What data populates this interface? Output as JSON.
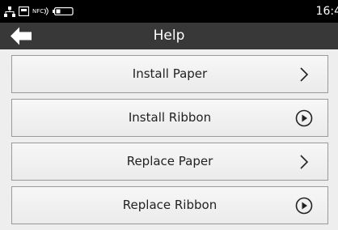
{
  "status_bar": {
    "time": "16:4",
    "icons": [
      "network-icon",
      "card-icon",
      "nfc-icon",
      "battery-icon"
    ],
    "nfc_label": "NFC"
  },
  "header": {
    "title": "Help",
    "back_icon": "back-arrow-icon"
  },
  "menu": {
    "items": [
      {
        "label": "Install Paper",
        "icon": "chevron-right-icon"
      },
      {
        "label": "Install Ribbon",
        "icon": "play-circle-icon"
      },
      {
        "label": "Replace Paper",
        "icon": "chevron-right-icon"
      },
      {
        "label": "Replace Ribbon",
        "icon": "play-circle-icon"
      }
    ]
  },
  "colors": {
    "status_bar_bg": "#000000",
    "title_bar_bg": "#383838",
    "page_bg": "#eeeeee",
    "button_border": "#9a9a9a",
    "text": "#222222"
  }
}
